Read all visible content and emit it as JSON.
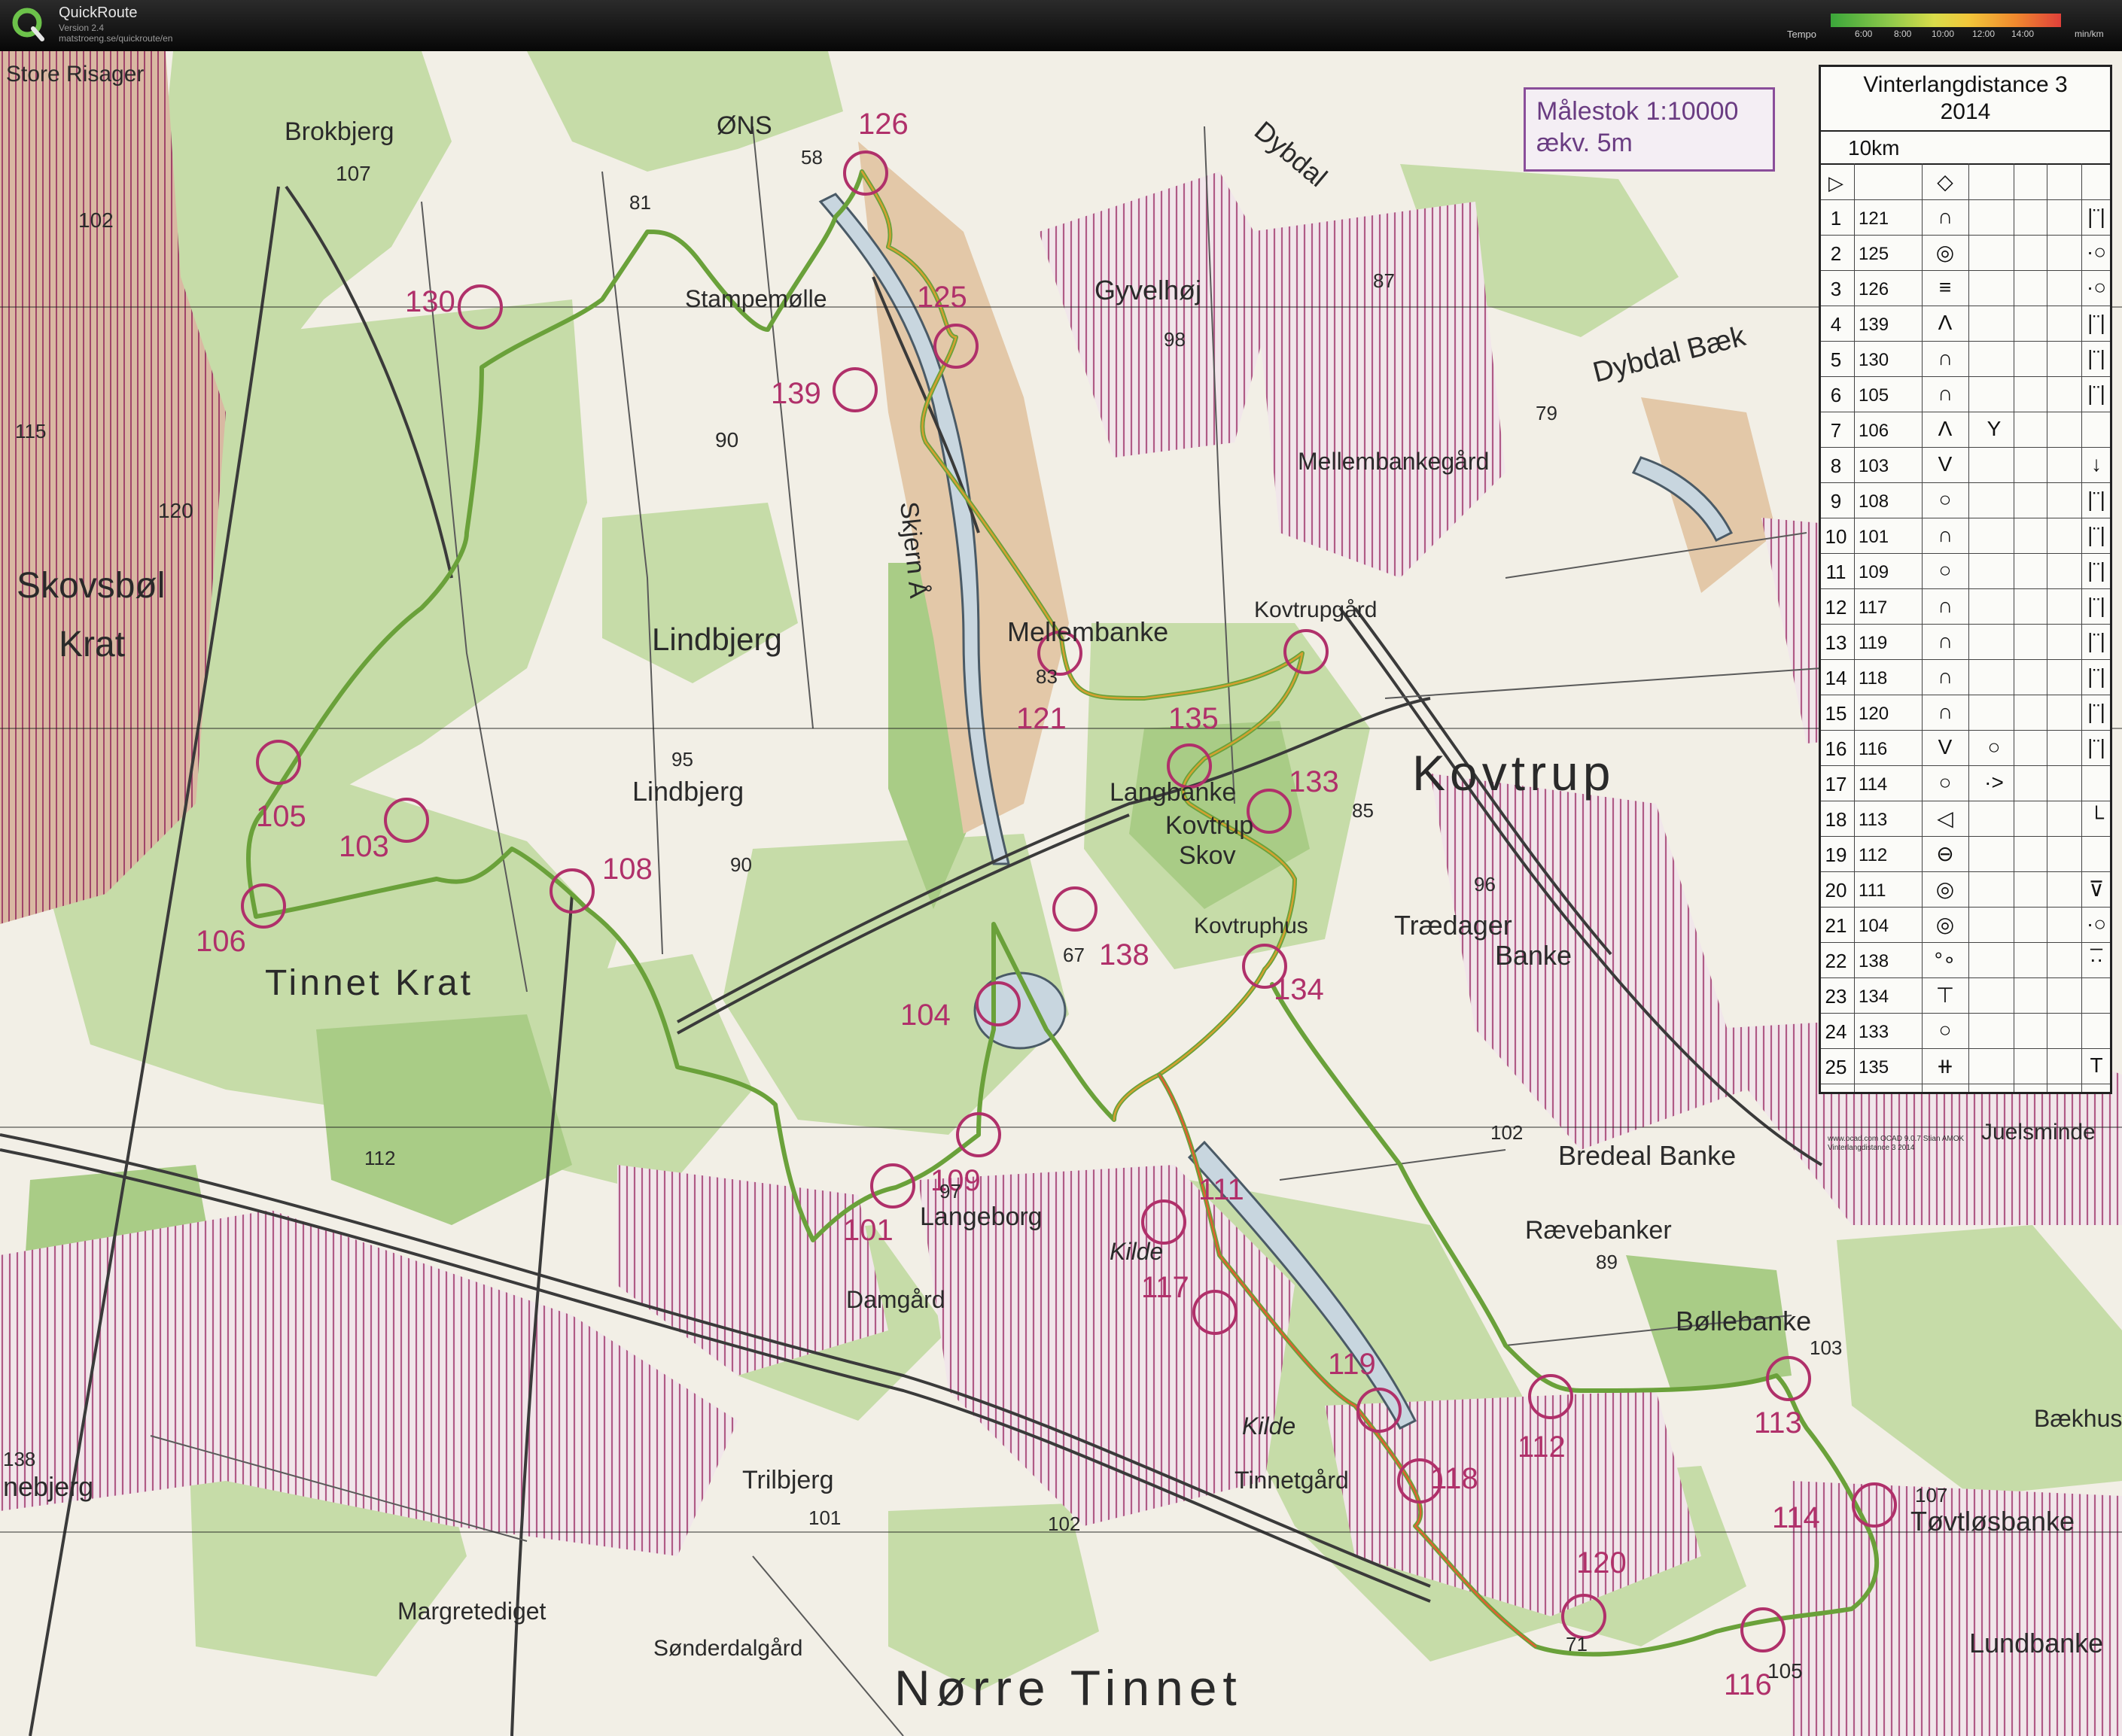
{
  "app": {
    "title": "QuickRoute",
    "version": "Version 2.4",
    "url": "matstroeng.se/quickroute/en"
  },
  "tempo": {
    "label": "Tempo",
    "ticks": [
      "6:00",
      "8:00",
      "10:00",
      "12:00",
      "14:00"
    ],
    "unit": "min/km",
    "colors": [
      "#3aa63a",
      "#7cc24a",
      "#c8d84a",
      "#f2d23a",
      "#f08a2e",
      "#e0403a"
    ]
  },
  "scale": {
    "line1": "Målestok 1:10000",
    "line2": "ækv. 5m"
  },
  "description": {
    "title_line1": "Vinterlangdistance 3",
    "title_line2": "2014",
    "distance": "10km",
    "start_symbol": "▷",
    "finish_symbol": "◇",
    "rows": [
      {
        "n": "1",
        "code": "121",
        "s1": "∩",
        "s2": "",
        "s3": "",
        "s4": "|¨|"
      },
      {
        "n": "2",
        "code": "125",
        "s1": "◎",
        "s2": "",
        "s3": "",
        "s4": "·○"
      },
      {
        "n": "3",
        "code": "126",
        "s1": "≡",
        "s2": "",
        "s3": "",
        "s4": "·○"
      },
      {
        "n": "4",
        "code": "139",
        "s1": "Λ",
        "s2": "",
        "s3": "",
        "s4": "|¨|"
      },
      {
        "n": "5",
        "code": "130",
        "s1": "∩",
        "s2": "",
        "s3": "",
        "s4": "|¨|"
      },
      {
        "n": "6",
        "code": "105",
        "s1": "∩",
        "s2": "",
        "s3": "",
        "s4": "|¨|"
      },
      {
        "n": "7",
        "code": "106",
        "s1": "Λ",
        "s2": "Y",
        "s3": "",
        "s4": ""
      },
      {
        "n": "8",
        "code": "103",
        "s1": "V",
        "s2": "",
        "s3": "",
        "s4": "↓"
      },
      {
        "n": "9",
        "code": "108",
        "s1": "○",
        "s2": "",
        "s3": "",
        "s4": "|¨|"
      },
      {
        "n": "10",
        "code": "101",
        "s1": "∩",
        "s2": "",
        "s3": "",
        "s4": "|¨|"
      },
      {
        "n": "11",
        "code": "109",
        "s1": "○",
        "s2": "",
        "s3": "",
        "s4": "|¨|"
      },
      {
        "n": "12",
        "code": "117",
        "s1": "∩",
        "s2": "",
        "s3": "",
        "s4": "|¨|"
      },
      {
        "n": "13",
        "code": "119",
        "s1": "∩",
        "s2": "",
        "s3": "",
        "s4": "|¨|"
      },
      {
        "n": "14",
        "code": "118",
        "s1": "∩",
        "s2": "",
        "s3": "",
        "s4": "|¨|"
      },
      {
        "n": "15",
        "code": "120",
        "s1": "∩",
        "s2": "",
        "s3": "",
        "s4": "|¨|"
      },
      {
        "n": "16",
        "code": "116",
        "s1": "V",
        "s2": "○",
        "s3": "",
        "s4": "|¨|"
      },
      {
        "n": "17",
        "code": "114",
        "s1": "○",
        "s2": "·>",
        "s3": "",
        "s4": ""
      },
      {
        "n": "18",
        "code": "113",
        "s1": "◁",
        "s2": "",
        "s3": "",
        "s4": "└"
      },
      {
        "n": "19",
        "code": "112",
        "s1": "⊖",
        "s2": "",
        "s3": "",
        "s4": ""
      },
      {
        "n": "20",
        "code": "111",
        "s1": "◎",
        "s2": "",
        "s3": "",
        "s4": "⊽"
      },
      {
        "n": "21",
        "code": "104",
        "s1": "◎",
        "s2": "",
        "s3": "",
        "s4": "·○"
      },
      {
        "n": "22",
        "code": "138",
        "s1": "°∘",
        "s2": "",
        "s3": "",
        "s4": "·̅·"
      },
      {
        "n": "23",
        "code": "134",
        "s1": "⊤",
        "s2": "",
        "s3": "",
        "s4": ""
      },
      {
        "n": "24",
        "code": "133",
        "s1": "○",
        "s2": "",
        "s3": "",
        "s4": ""
      },
      {
        "n": "25",
        "code": "135",
        "s1": "⧺",
        "s2": "",
        "s3": "",
        "s4": "T"
      }
    ],
    "copyright": "www.ocad.com OCAD 9.0.7 Stian AMOK Vinterlangdistance 3 2014"
  },
  "map_labels": [
    "Store Risager",
    "Brokbjerg",
    "107",
    "102",
    "ØNS",
    "58",
    "81",
    "Stampemølle",
    "Gyvelhøj",
    "98",
    "87",
    "Dybdal Bæk",
    "Dybdal",
    "79",
    "Mellembankegård",
    "115",
    "120",
    "Skovsbøl",
    "Krat",
    "90",
    "Skjern Å",
    "Lindbjerg",
    "Mellembanke",
    "83",
    "Kovtrupgård",
    "Kovtrup",
    "95",
    "Lindbjerg",
    "90",
    "Langbanke",
    "Kovtrup",
    "Skov",
    "85",
    "96",
    "Trædager",
    "Banke",
    "Kovtruphus",
    "67",
    "Tinnet Krat",
    "112",
    "97",
    "Langeborg",
    "Kilde",
    "102",
    "Bredeal Banke",
    "Juelsminde",
    "Rævebanker",
    "89",
    "Bøllebanke",
    "103",
    "Damgård",
    "Kilde",
    "Tinnetgård",
    "Bækhus",
    "107",
    "Tøvtløsbanke",
    "138",
    "nebjerg",
    "Trilbjerg",
    "101",
    "102",
    "Margretediget",
    "Sønderdalgård",
    "71",
    "Nørre Tinnet",
    "105",
    "Lundbanke"
  ],
  "control_labels": [
    "126",
    "130",
    "125",
    "139",
    "121",
    "135",
    "133",
    "105",
    "103",
    "108",
    "106",
    "138",
    "104",
    "134",
    "109",
    "101",
    "111",
    "117",
    "119",
    "118",
    "112",
    "113",
    "114",
    "120",
    "116"
  ]
}
